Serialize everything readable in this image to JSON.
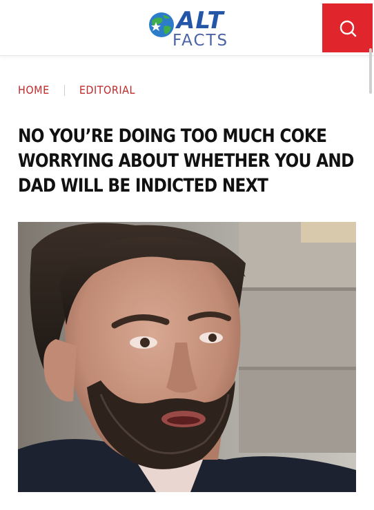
{
  "header": {
    "logo": {
      "primary_text": "ALT",
      "secondary_text": "FACTS"
    },
    "search_icon": "search-icon"
  },
  "breadcrumb": {
    "items": [
      "HOME",
      "EDITORIAL"
    ]
  },
  "article": {
    "headline_lines": [
      "NO YOU’RE DOING TOO MUCH COKE",
      "WORRYING ABOUT WHETHER YOU AND",
      "DAD WILL BE INDICTED NEXT"
    ],
    "image": "photo-of-bearded-man"
  },
  "colors": {
    "accent_red": "#e0262c",
    "breadcrumb_red": "#c0292b",
    "logo_blue": "#2456a8"
  }
}
